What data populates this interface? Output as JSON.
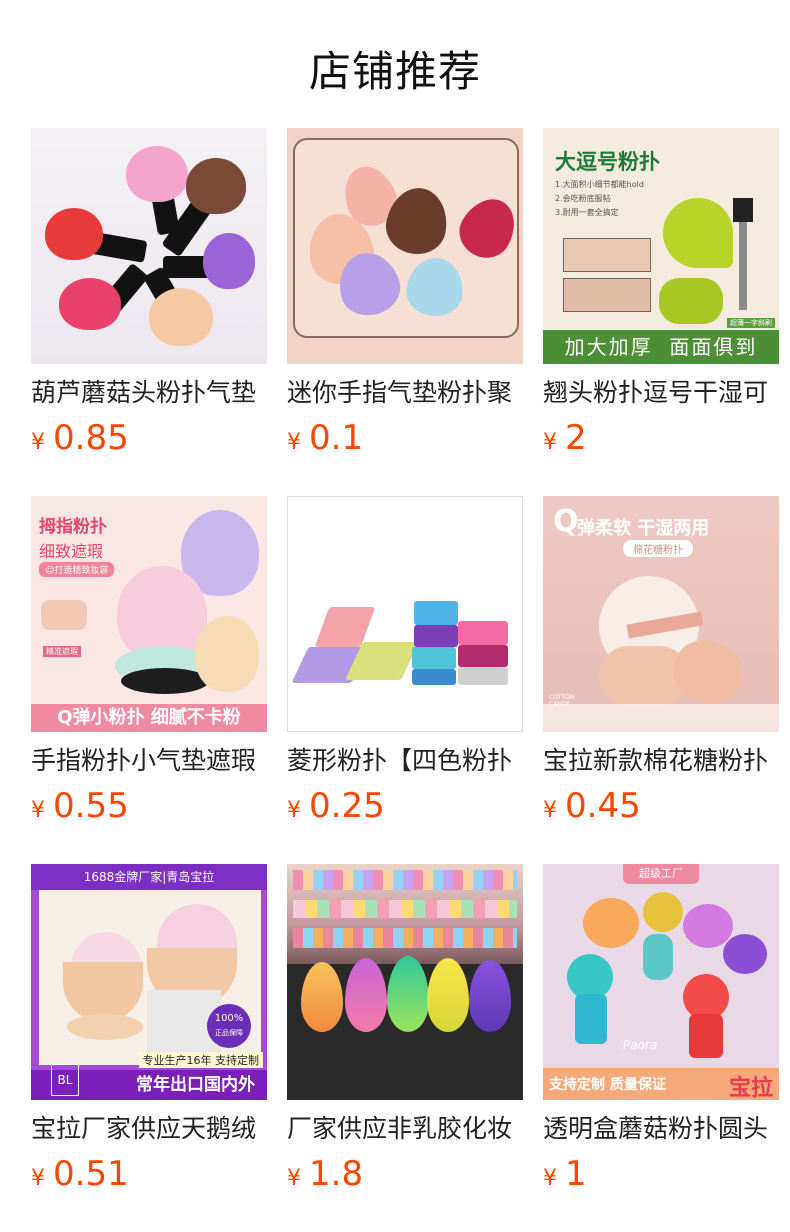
{
  "header": {
    "title": "店铺推荐"
  },
  "currency_symbol": "¥",
  "products": [
    {
      "name": "葫芦蘑菇头粉扑气垫",
      "price": "0.85"
    },
    {
      "name": "迷你手指气垫粉扑聚",
      "price": "0.1"
    },
    {
      "name": "翘头粉扑逗号干湿可",
      "price": "2",
      "image_text": {
        "title": "大逗号粉扑",
        "lines": [
          "1.大面积小细节都能hold",
          "2.会吃粉底服帖",
          "3.耐用一套全搞定"
        ],
        "badge": "加大加厚",
        "badge2": "面面俱到",
        "tag": "超薄一字斜刷"
      }
    },
    {
      "name": "手指粉扑小气垫遮瑕",
      "price": "0.55",
      "image_text": {
        "line1": "拇指粉扑",
        "line2": "细致遮瑕",
        "line3": "☺打造精致妆容",
        "note": "精准遮瑕",
        "band": "Q弹小粉扑 细腻不卡粉"
      }
    },
    {
      "name": "菱形粉扑【四色粉扑",
      "price": "0.25"
    },
    {
      "name": "宝拉新款棉花糖粉扑",
      "price": "0.45",
      "image_text": {
        "q": "Q",
        "line1": "弹柔软 干湿两用",
        "line2": "棉花糖粉扑",
        "corner": "COTTON CANDY"
      }
    },
    {
      "name": "宝拉厂家供应天鹅绒",
      "price": "0.51",
      "image_text": {
        "top": "1688金牌厂家|青岛宝拉",
        "seal": "100%",
        "seal2": "正品保障",
        "note": "专业生产16年 支持定制",
        "band": "常年出口国内外",
        "logo": "BL"
      }
    },
    {
      "name": "厂家供应非乳胶化妆",
      "price": "1.8"
    },
    {
      "name": "透明盒蘑菇粉扑圆头",
      "price": "1",
      "image_text": {
        "top": "超级工厂",
        "script": "Paora",
        "band_left": "支持定制 质量保证",
        "band_right": "宝拉"
      }
    }
  ],
  "colors": {
    "price": "#ff4400",
    "title": "#111111",
    "name": "#222222"
  }
}
